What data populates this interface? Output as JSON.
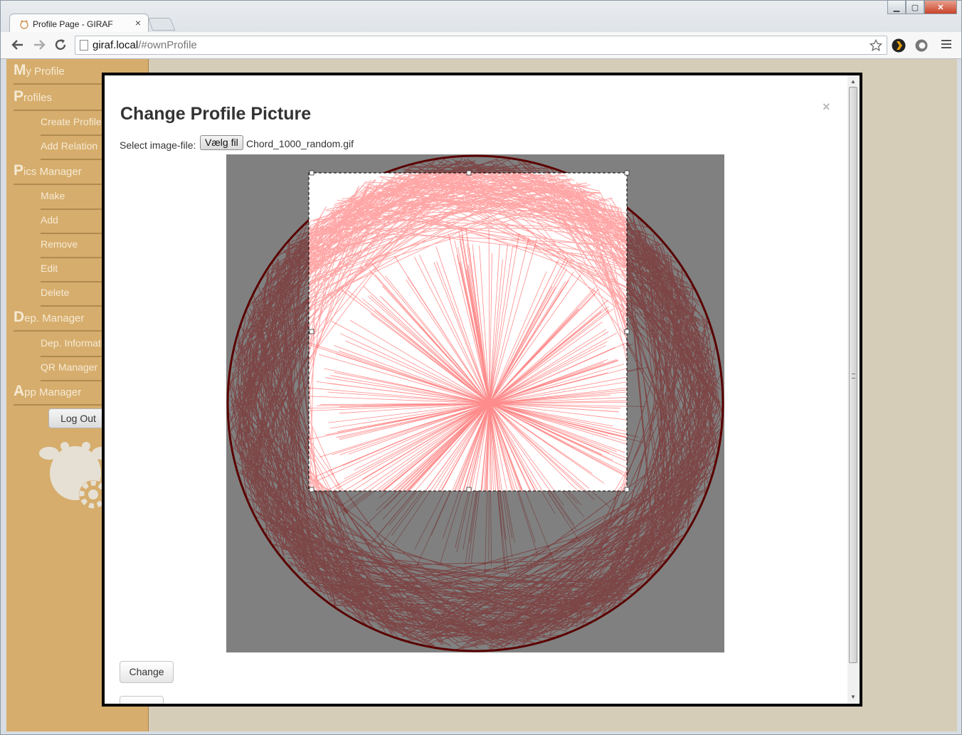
{
  "browser": {
    "tab_title": "Profile Page - GIRAF",
    "tab_close": "×",
    "url_host": "giraf.local",
    "url_path": "/#ownProfile",
    "window_buttons": {
      "minimize": "▁",
      "maximize": "▢",
      "close": "✕"
    }
  },
  "sidebar": {
    "my_profile": {
      "initial": "M",
      "rest": "y Profile"
    },
    "profiles": {
      "initial": "P",
      "rest": "rofiles"
    },
    "create_profile": "Create Profile",
    "add_relation": "Add Relation",
    "pics_manager": {
      "initial": "P",
      "rest": "ics Manager"
    },
    "make": "Make",
    "add": "Add",
    "remove": "Remove",
    "edit": "Edit",
    "delete": "Delete",
    "dep_manager": {
      "initial": "D",
      "rest": "ep. Manager"
    },
    "dep_information": "Dep. Information",
    "qr_manager": "QR Manager",
    "app_manager": {
      "initial": "A",
      "rest": "pp Manager"
    },
    "logout_label": "Log Out"
  },
  "modal": {
    "title": "Change Profile Picture",
    "close_symbol": "×",
    "file_label": "Select image-file:",
    "file_button": "Vælg fil",
    "file_name": "Chord_1000_random.gif",
    "change_button": "Change"
  },
  "colors": {
    "sidebar_bg": "#d6ad6c",
    "page_bg": "#d6cdb8",
    "chord_red": "#ff0000",
    "chord_dark": "#8b0000",
    "image_bg": "#808080"
  }
}
